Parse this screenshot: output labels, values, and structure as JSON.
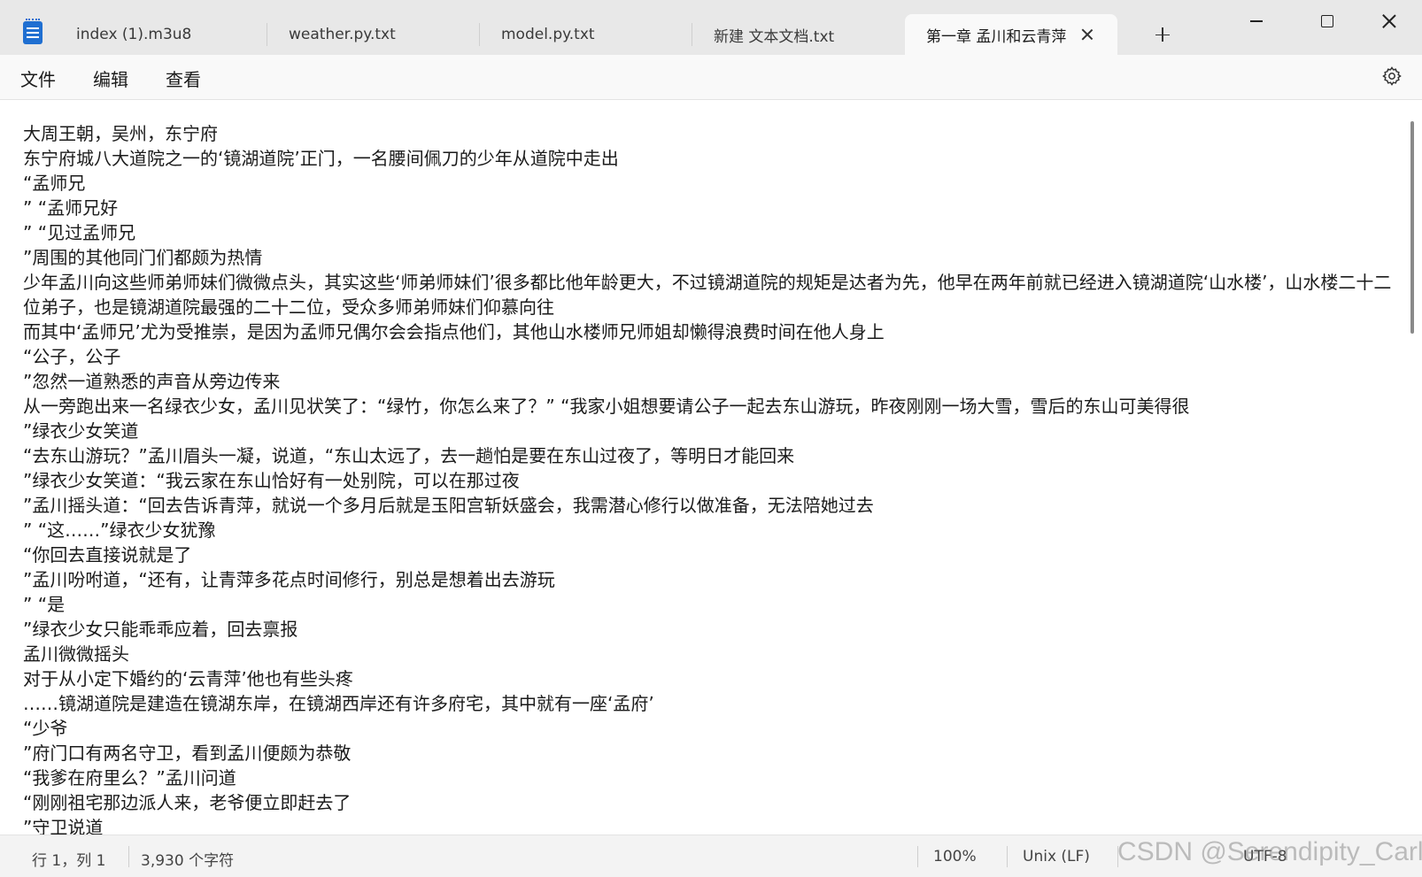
{
  "tabs": [
    {
      "label": "index (1).m3u8"
    },
    {
      "label": "weather.py.txt"
    },
    {
      "label": "model.py.txt"
    },
    {
      "label": "新建 文本文档.txt"
    },
    {
      "label": "第一章 孟川和云青萍"
    }
  ],
  "menu": {
    "file": "文件",
    "edit": "编辑",
    "view": "查看"
  },
  "icons": {
    "app": "notepad-icon",
    "close_tab": "close-icon",
    "new_tab": "plus-icon",
    "settings": "gear-icon"
  },
  "document": {
    "lines": [
      "大周王朝，吴州，东宁府",
      "东宁府城八大道院之一的‘镜湖道院’正门，一名腰间佩刀的少年从道院中走出",
      "“孟师兄",
      "” “孟师兄好",
      "” “见过孟师兄",
      "”周围的其他同门们都颇为热情",
      "少年孟川向这些师弟师妹们微微点头，其实这些‘师弟师妹们’很多都比他年龄更大，不过镜湖道院的规矩是达者为先，他早在两年前就已经进入镜湖道院‘山水楼’，山水楼二十二位弟子，也是镜湖道院最强的二十二位，受众多师弟师妹们仰慕向往",
      "而其中‘孟师兄’尤为受推崇，是因为孟师兄偶尔会会指点他们，其他山水楼师兄师姐却懒得浪费时间在他人身上",
      "“公子，公子",
      "”忽然一道熟悉的声音从旁边传来",
      "从一旁跑出来一名绿衣少女，孟川见状笑了：“绿竹，你怎么来了？” “我家小姐想要请公子一起去东山游玩，昨夜刚刚一场大雪，雪后的东山可美得很",
      "”绿衣少女笑道",
      "“去东山游玩？”孟川眉头一凝，说道，“东山太远了，去一趟怕是要在东山过夜了，等明日才能回来",
      "”绿衣少女笑道：“我云家在东山恰好有一处别院，可以在那过夜",
      "”孟川摇头道：“回去告诉青萍，就说一个多月后就是玉阳宫斩妖盛会，我需潜心修行以做准备，无法陪她过去",
      "” “这……”绿衣少女犹豫",
      "“你回去直接说就是了",
      "”孟川吩咐道，“还有，让青萍多花点时间修行，别总是想着出去游玩",
      "” “是",
      "”绿衣少女只能乖乖应着，回去禀报",
      "孟川微微摇头",
      "对于从小定下婚约的‘云青萍’他也有些头疼",
      "……镜湖道院是建造在镜湖东岸，在镜湖西岸还有许多府宅，其中就有一座‘孟府’",
      "“少爷",
      "”府门口有两名守卫，看到孟川便颇为恭敬",
      "“我爹在府里么？”孟川问道",
      "“刚刚祖宅那边派人来，老爷便立即赶去了",
      "”守卫说道"
    ]
  },
  "status": {
    "position": "行 1，列 1",
    "char_count": "3,930 个字符",
    "zoom": "100%",
    "line_ending": "Unix (LF)",
    "encoding": "UTF-8"
  },
  "watermark": "CSDN @Serendipity_Carl"
}
